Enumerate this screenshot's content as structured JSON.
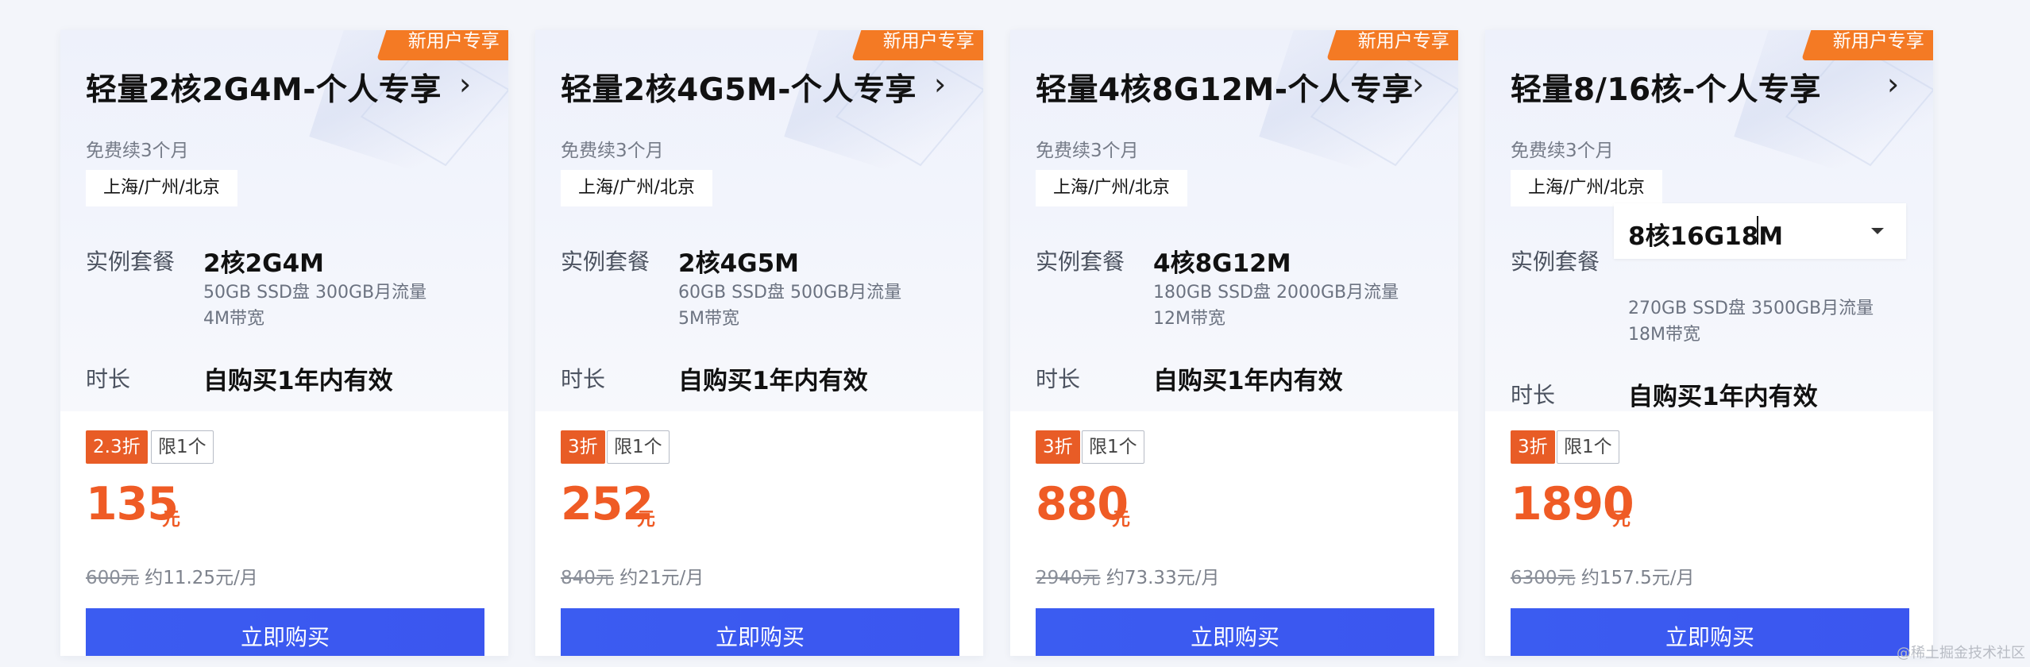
{
  "cards": [
    {
      "ribbon": "新用户专享",
      "title": "轻量2核2G4M-个人专享",
      "renewal": "免费续3个月",
      "region": "上海/广州/北京",
      "package_label": "实例套餐",
      "package_value": "2核2G4M",
      "package_desc_1": "50GB SSD盘 300GB月流量",
      "package_desc_2": "4M带宽",
      "duration_label": "时长",
      "duration_value": "自购买1年内有效",
      "discount": "2.3折",
      "limit": "限1个",
      "price": "135",
      "unit": "元",
      "original_price": "600元",
      "monthly": "约11.25元/月",
      "buy_label": "立即购买"
    },
    {
      "ribbon": "新用户专享",
      "title": "轻量2核4G5M-个人专享",
      "renewal": "免费续3个月",
      "region": "上海/广州/北京",
      "package_label": "实例套餐",
      "package_value": "2核4G5M",
      "package_desc_1": "60GB SSD盘 500GB月流量",
      "package_desc_2": "5M带宽",
      "duration_label": "时长",
      "duration_value": "自购买1年内有效",
      "discount": "3折",
      "limit": "限1个",
      "price": "252",
      "unit": "元",
      "original_price": "840元",
      "monthly": "约21元/月",
      "buy_label": "立即购买"
    },
    {
      "ribbon": "新用户专享",
      "title": "轻量4核8G12M-个人专享",
      "renewal": "免费续3个月",
      "region": "上海/广州/北京",
      "package_label": "实例套餐",
      "package_value": "4核8G12M",
      "package_desc_1": "180GB SSD盘 2000GB月流量",
      "package_desc_2": "12M带宽",
      "duration_label": "时长",
      "duration_value": "自购买1年内有效",
      "discount": "3折",
      "limit": "限1个",
      "price": "880",
      "unit": "元",
      "original_price": "2940元",
      "monthly": "约73.33元/月",
      "buy_label": "立即购买"
    },
    {
      "ribbon": "新用户专享",
      "title": "轻量8/16核-个人专享",
      "renewal": "免费续3个月",
      "region": "上海/广州/北京",
      "package_label": "实例套餐",
      "package_value": "8核16G18M",
      "package_desc_1": "270GB SSD盘 3500GB月流量",
      "package_desc_2": "18M带宽",
      "duration_label": "时长",
      "duration_value": "自购买1年内有效",
      "discount": "3折",
      "limit": "限1个",
      "price": "1890",
      "unit": "元",
      "original_price": "6300元",
      "monthly": "约157.5元/月",
      "buy_label": "立即购买"
    }
  ],
  "watermark": "@稀土掘金技术社区",
  "colors": {
    "accent_orange": "#ef5b25",
    "ribbon_orange": "#f47a24",
    "button_blue": "#3b5cf1"
  },
  "icons": {
    "title_arrow": "chevron-right-icon",
    "select_arrow": "caret-down-icon"
  }
}
